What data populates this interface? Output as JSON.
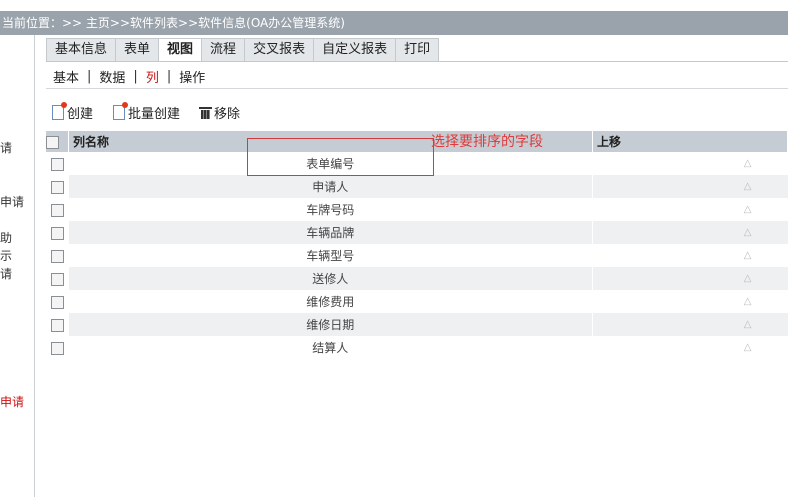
{
  "breadcrumb": "当前位置：>> 主页>>软件列表>>软件信息(OA办公管理系统)",
  "left_panel": {
    "items": [
      {
        "text": "请",
        "red": false
      },
      {
        "text": "申请",
        "red": false
      },
      {
        "text": "助",
        "red": false
      },
      {
        "text": "示",
        "red": false
      },
      {
        "text": "请",
        "red": false
      },
      {
        "text": "申请",
        "red": true
      }
    ]
  },
  "tabs": [
    {
      "label": "基本信息",
      "active": false
    },
    {
      "label": "表单",
      "active": false
    },
    {
      "label": "视图",
      "active": true
    },
    {
      "label": "流程",
      "active": false
    },
    {
      "label": "交叉报表",
      "active": false
    },
    {
      "label": "自定义报表",
      "active": false
    },
    {
      "label": "打印",
      "active": false
    }
  ],
  "subtabs": [
    {
      "label": "基本",
      "active": false
    },
    {
      "label": "数据",
      "active": false
    },
    {
      "label": "列",
      "active": true
    },
    {
      "label": "操作",
      "active": false
    }
  ],
  "toolbar": {
    "create": "创建",
    "batch_create": "批量创建",
    "remove": "移除"
  },
  "table": {
    "headers": {
      "name": "列名称",
      "up": "上移"
    },
    "up_symbol": "△",
    "rows": [
      "表单编号",
      "申请人",
      "车牌号码",
      "车辆品牌",
      "车辆型号",
      "送修人",
      "维修费用",
      "维修日期",
      "结算人"
    ]
  },
  "annotation": {
    "text": "选择要排序的字段",
    "color": "#e03a3a"
  }
}
